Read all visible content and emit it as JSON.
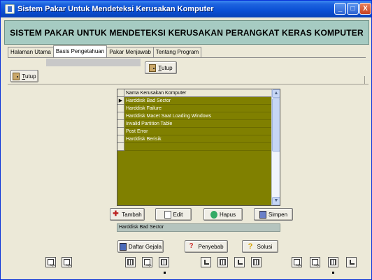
{
  "window": {
    "title": "Sistem Pakar Untuk Mendeteksi Kerusakan Komputer",
    "buttons": {
      "minimize": "_",
      "maximize": "□",
      "close": "X"
    }
  },
  "header": {
    "title": "SISTEM PAKAR UNTUK MENDETEKSI KERUSAKAN PERANGKAT KERAS KOMPUTER"
  },
  "tabs": [
    {
      "label": "Halaman Utama"
    },
    {
      "label": "Basis Pengetahuan"
    },
    {
      "label": "Pakar Menjawab"
    },
    {
      "label": "Tentang Program"
    }
  ],
  "active_tab": "Basis Pengetahuan",
  "buttons": {
    "tutup_left": {
      "hotkey": "T",
      "rest": "utup"
    },
    "tutup_right": {
      "hotkey": "T",
      "rest": "utup"
    },
    "tambah": "Tambah",
    "edit": "Edit",
    "hapus": "Hapus",
    "simpen": "Simpen",
    "daftar_gejala": "Daftar Gejala",
    "penyebab": "Penyebab",
    "solusi": "Solusi"
  },
  "grid": {
    "column_header": "Nama Kerusakan Komputer",
    "rows": [
      "Harddisk Bad Sector",
      "Harddisk Failure",
      "Harddisk Macet Saat Loading Windows",
      "Invalid Partition Table",
      "Post Error",
      "Harddisk Berisik"
    ],
    "current_row_indicator": "▶",
    "scroll_up": "▲",
    "scroll_down": "▼"
  },
  "selected_value": "Harddisk Bad Sector",
  "icons": {
    "nav_left": [
      "sql-icon",
      "sql-icon"
    ],
    "nav_middle": [
      "grid-icon",
      "sql-icon",
      "grid-icon"
    ],
    "nav_center_right": [
      "arrow-icon",
      "grid-icon",
      "arrow-icon",
      "grid-icon"
    ],
    "nav_right": [
      "sql-icon",
      "sql-icon",
      "grid-icon",
      "arrow-icon"
    ]
  },
  "colors": {
    "title_bar": "#0A4FD4",
    "header_bg": "#A6CBC2",
    "grid_bg": "#808000",
    "window_bg": "#ECE9D8",
    "status_field_bg": "#B5C4BE"
  }
}
